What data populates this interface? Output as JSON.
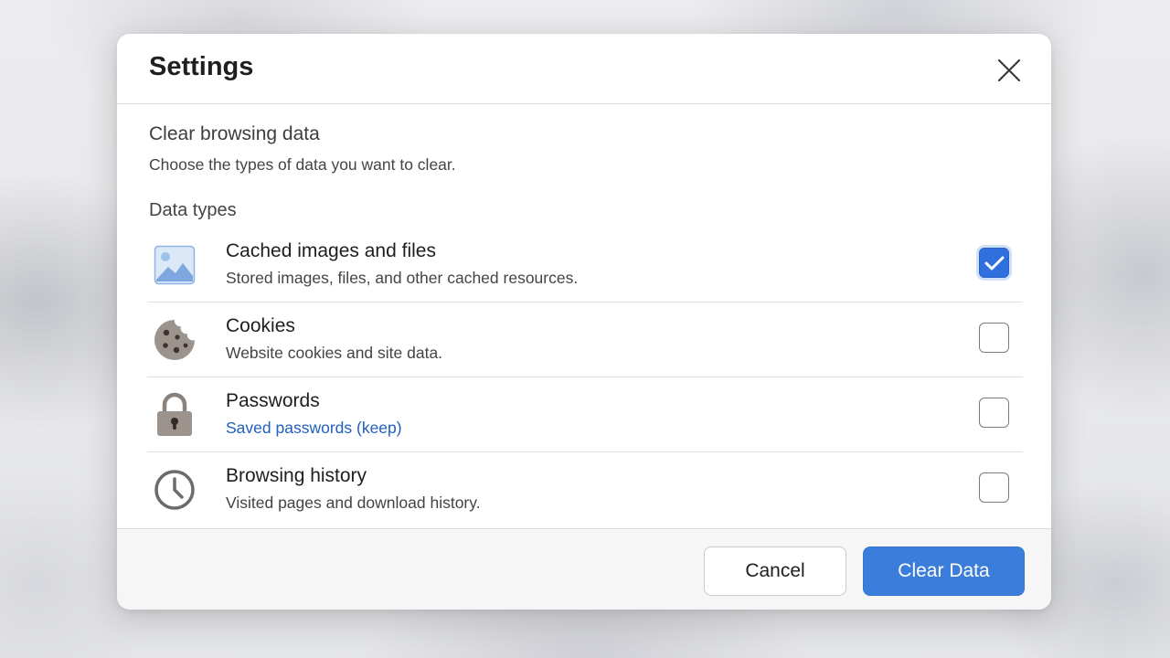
{
  "dialog": {
    "title": "Settings",
    "close_icon": "close-icon"
  },
  "section": {
    "title": "Clear browsing data",
    "subtitle": "Choose the types of data you want to clear.",
    "group_label": "Data types"
  },
  "items": [
    {
      "icon": "image-icon",
      "label": "Cached images and files",
      "description": "Stored images, files, and other cached resources.",
      "checked": true
    },
    {
      "icon": "cookie-icon",
      "label": "Cookies",
      "description": "Website cookies and site data.",
      "checked": false
    },
    {
      "icon": "lock-icon",
      "label": "Passwords",
      "description": "Saved passwords (keep)",
      "description_is_link": true,
      "checked": false
    },
    {
      "icon": "clock-icon",
      "label": "Browsing history",
      "description": "Visited pages and download history.",
      "checked": false
    }
  ],
  "footer": {
    "cancel_label": "Cancel",
    "confirm_label": "Clear Data"
  },
  "colors": {
    "accent": "#3b7ddb",
    "checkbox_checked": "#2f6fde",
    "link": "#1f5fbf"
  }
}
